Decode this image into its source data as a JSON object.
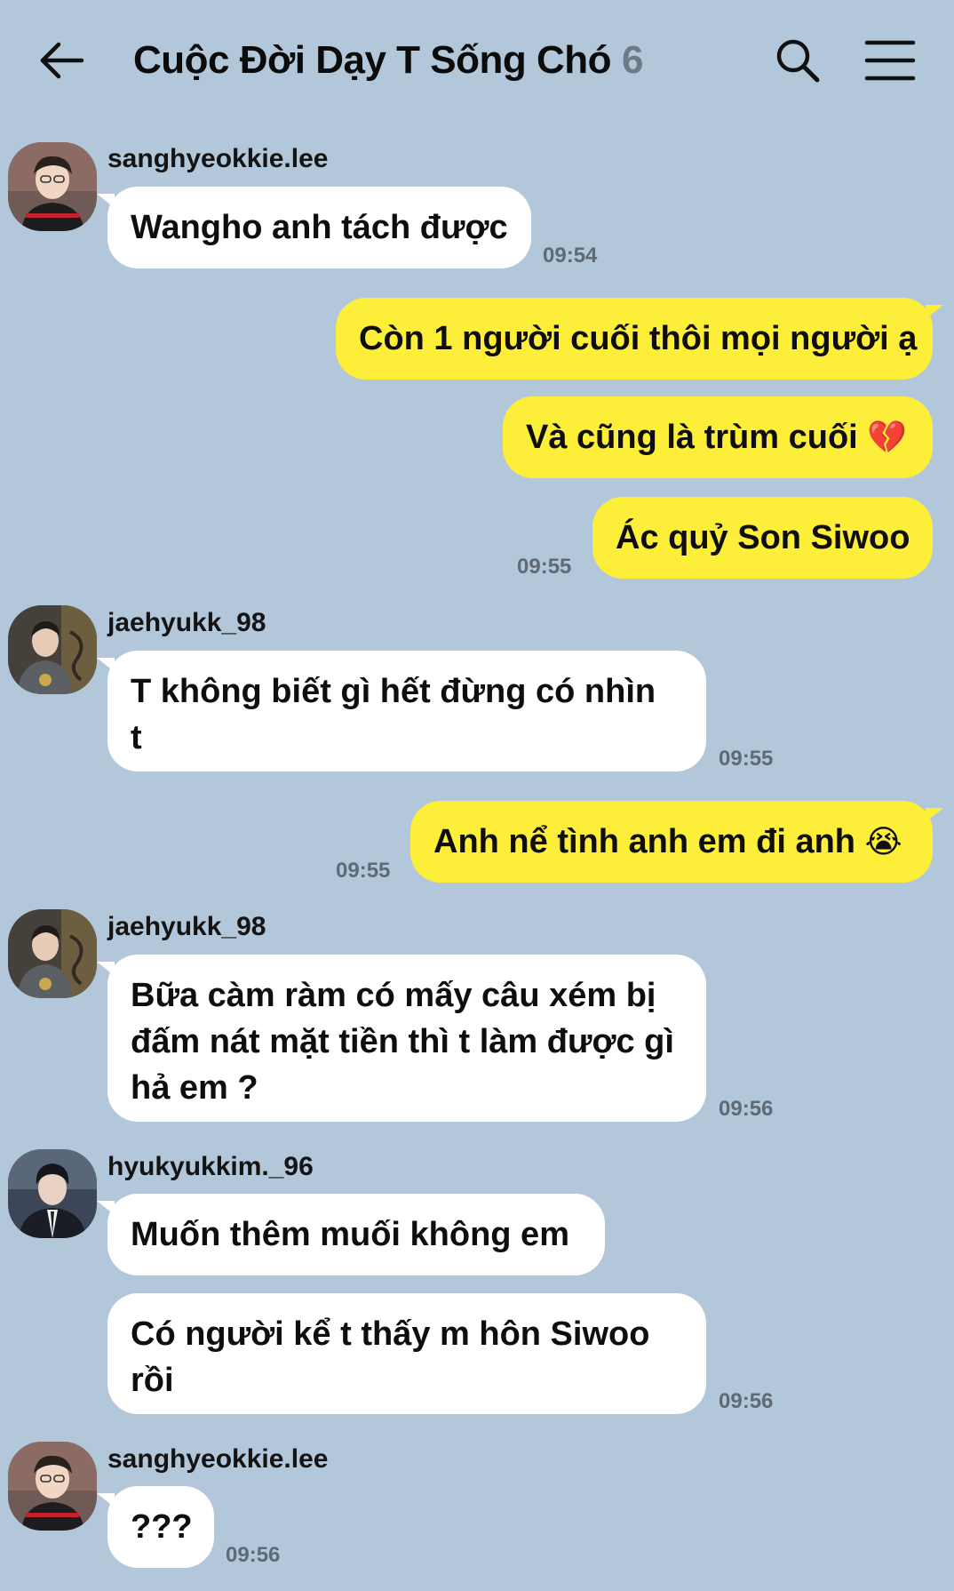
{
  "header": {
    "title": "Cuộc Đời Dạy T Sống Chó",
    "member_count": "6"
  },
  "messages": [
    {
      "sender": "sanghyeokkie.lee",
      "text": "Wangho anh tách được",
      "time": "09:54"
    },
    {
      "outgoing": true,
      "text": "Còn 1 người cuối thôi mọi người ạ"
    },
    {
      "outgoing": true,
      "text": "Và cũng là trùm cuối",
      "emoji": "💔"
    },
    {
      "outgoing": true,
      "text": "Ác quỷ Son Siwoo",
      "time": "09:55"
    },
    {
      "sender": "jaehyukk_98",
      "line1": "T không biết gì hết đừng có nhìn",
      "line2": "t",
      "time": "09:55"
    },
    {
      "outgoing": true,
      "text": "Anh nể tình anh em đi anh",
      "emoji": "😭",
      "time": "09:55"
    },
    {
      "sender": "jaehyukk_98",
      "line1": "Bữa càm ràm có mấy câu xém bị",
      "line2": "đấm nát mặt tiền thì t làm được gì",
      "line3": "hả em ?",
      "time": "09:56"
    },
    {
      "sender": "hyukyukkim._96",
      "text": "Muốn thêm muối không em"
    },
    {
      "line1": "Có người kể t thấy m hôn Siwoo",
      "line2": "rồi",
      "time": "09:56"
    },
    {
      "sender": "sanghyeokkie.lee",
      "text": "???",
      "time": "09:56"
    }
  ]
}
